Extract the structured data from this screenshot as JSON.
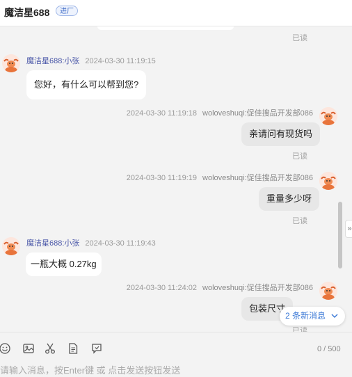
{
  "header": {
    "title": "魔洁星688",
    "badge": "进厂"
  },
  "messages": [
    {
      "side": "left",
      "name": "魔洁星688:小张",
      "time": "2024-03-30 11:19:15",
      "text": "您好，有什么可以帮到您?"
    },
    {
      "side": "right",
      "name": "woloveshuqi:促佳搜品开发部086",
      "time": "2024-03-30 11:19:18",
      "text": "亲请问有现货吗",
      "status": "已读"
    },
    {
      "side": "right",
      "name": "woloveshuqi:促佳搜品开发部086",
      "time": "2024-03-30 11:19:19",
      "text": "重量多少呀",
      "status": "已读"
    },
    {
      "side": "left",
      "name": "魔洁星688:小张",
      "time": "2024-03-30 11:19:43",
      "text": "一瓶大概 0.27kg"
    },
    {
      "side": "right",
      "name": "woloveshuqi:促佳搜品开发部086",
      "time": "2024-03-30 11:24:02",
      "text": "包装尺寸",
      "status": "已读"
    }
  ],
  "top_read": "已读",
  "new_messages": "2 条新消息",
  "composer": {
    "counter": "0 / 500",
    "placeholder": "请输入消息，按Enter键 或 点击发送按钮发送",
    "tools": [
      "emoji-icon",
      "image-icon",
      "scissors-icon",
      "document-icon",
      "quick-reply-icon"
    ]
  },
  "colors": {
    "sender_name": "#4a57a8",
    "link_blue": "#3a78d6",
    "badge_blue": "#3a68c6"
  }
}
